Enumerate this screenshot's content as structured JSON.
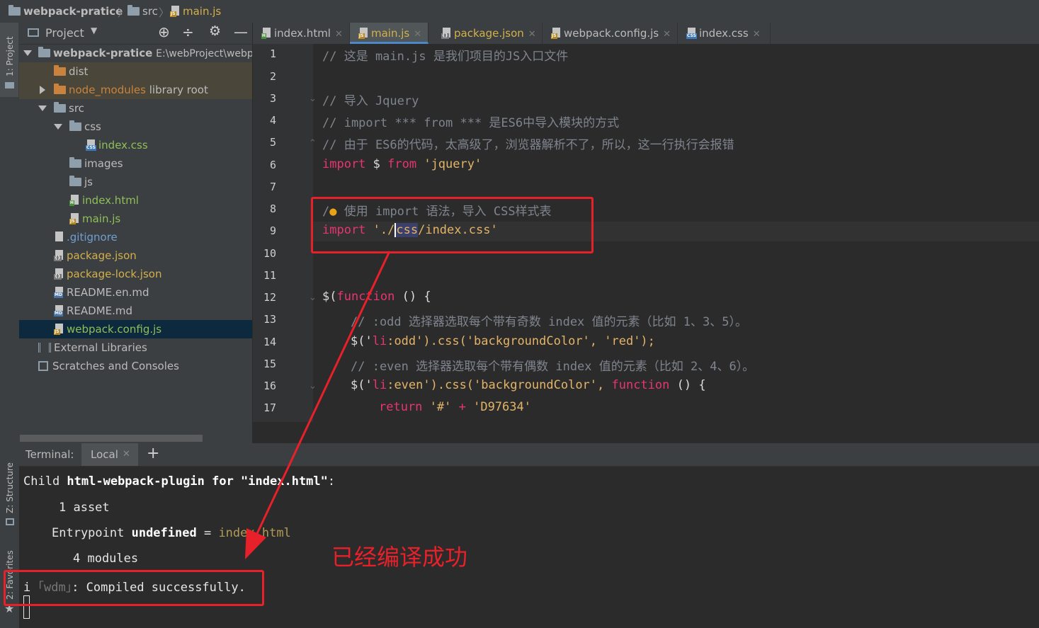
{
  "breadcrumb": {
    "project": "webpack-pratice",
    "folder": "src",
    "file": "main.js"
  },
  "tool_strip": {
    "project": "1: Project",
    "structure": "Z: Structure",
    "favorites": "2: Favorites"
  },
  "project_panel": {
    "title": "Project",
    "tree": [
      {
        "label": "webpack-pratice",
        "extra": "E:\\webProject\\webp",
        "kind": "root"
      },
      {
        "label": "dist",
        "kind": "folder-orange"
      },
      {
        "label": "node_modules",
        "extra": "library root",
        "kind": "folder-orange"
      },
      {
        "label": "src",
        "kind": "folder"
      },
      {
        "label": "css",
        "kind": "folder"
      },
      {
        "label": "index.css",
        "kind": "css"
      },
      {
        "label": "images",
        "kind": "folder"
      },
      {
        "label": "js",
        "kind": "folder"
      },
      {
        "label": "index.html",
        "kind": "html"
      },
      {
        "label": "main.js",
        "kind": "js"
      },
      {
        "label": ".gitignore",
        "kind": "file"
      },
      {
        "label": "package.json",
        "kind": "json"
      },
      {
        "label": "package-lock.json",
        "kind": "json"
      },
      {
        "label": "README.en.md",
        "kind": "md"
      },
      {
        "label": "README.md",
        "kind": "md"
      },
      {
        "label": "webpack.config.js",
        "kind": "js"
      },
      {
        "label": "External Libraries",
        "kind": "lib"
      },
      {
        "label": "Scratches and Consoles",
        "kind": "scratch"
      }
    ]
  },
  "tabs": [
    {
      "label": "index.html",
      "icon": "html-file-icon"
    },
    {
      "label": "main.js",
      "icon": "js-file-icon",
      "active": true
    },
    {
      "label": "package.json",
      "icon": "json-file-icon"
    },
    {
      "label": "webpack.config.js",
      "icon": "js-file-icon"
    },
    {
      "label": "index.css",
      "icon": "css-file-icon"
    }
  ],
  "editor": {
    "line_numbers": [
      "1",
      "2",
      "3",
      "4",
      "5",
      "6",
      "7",
      "8",
      "9",
      "10",
      "11",
      "12",
      "13",
      "14",
      "15",
      "16",
      "17"
    ],
    "lines": {
      "l1": "// 这是 main.js 是我们项目的JS入口文件",
      "l3": "// 导入 Jquery",
      "l4": "// import *** from *** 是ES6中导入模块的方式",
      "l5": "// 由于 ES6的代码，太高级了，浏览器解析不了，所以，这一行执行会报错",
      "l6a": "import",
      "l6b": " $ ",
      "l6c": "from",
      "l6d": " 'jquery'",
      "l8a": "/",
      "l8b": " 使用 import 语法，导入 CSS样式表",
      "l9a": "import",
      "l9b": " './",
      "l9c": "css",
      "l9d": "/index.css'",
      "l12a": "$(",
      "l12b": "function",
      "l12c": " () {",
      "l13": "// :odd 选择器选取每个带有奇数 index 值的元素（比如 1、3、5）。",
      "l14a": "$('",
      "l14b": "li",
      ":l14c": "",
      "l14d": ":odd",
      "l14e": "').css('backgroundColor', 'red');",
      "l15": "// :even 选择器选取每个带有偶数 index 值的元素（比如 2、4、6）。",
      "l16a": "$('",
      "l16b": "li",
      "l16d": ":even",
      "l16e": "').css('backgroundColor', ",
      "l16f": "function",
      "l16g": " () {",
      "l17a": "return",
      "l17b": " '#' ",
      "l17c": "+",
      "l17d": " 'D97634'"
    }
  },
  "terminal": {
    "label": "Terminal:",
    "tab": "Local",
    "lines": {
      "t1a": "Child ",
      "t1b": "html-webpack-plugin for \"index.html\"",
      ":t1c": "",
      "t1c": ":",
      "t2": "1 asset",
      "t3a": "Entrypoint ",
      "t3b": "undefined",
      "t3c": " = ",
      "t3d": "index.html",
      "t4": "4 modules",
      "t5a": "i ",
      "t5b": "｢wdm｣",
      "t5c": ": Compiled successfully."
    }
  },
  "annotation": "已经编译成功",
  "colors": {
    "annotation": "#e8202a",
    "keyword": "#e8356f",
    "string": "#e3b468",
    "comment": "#7f848e"
  }
}
